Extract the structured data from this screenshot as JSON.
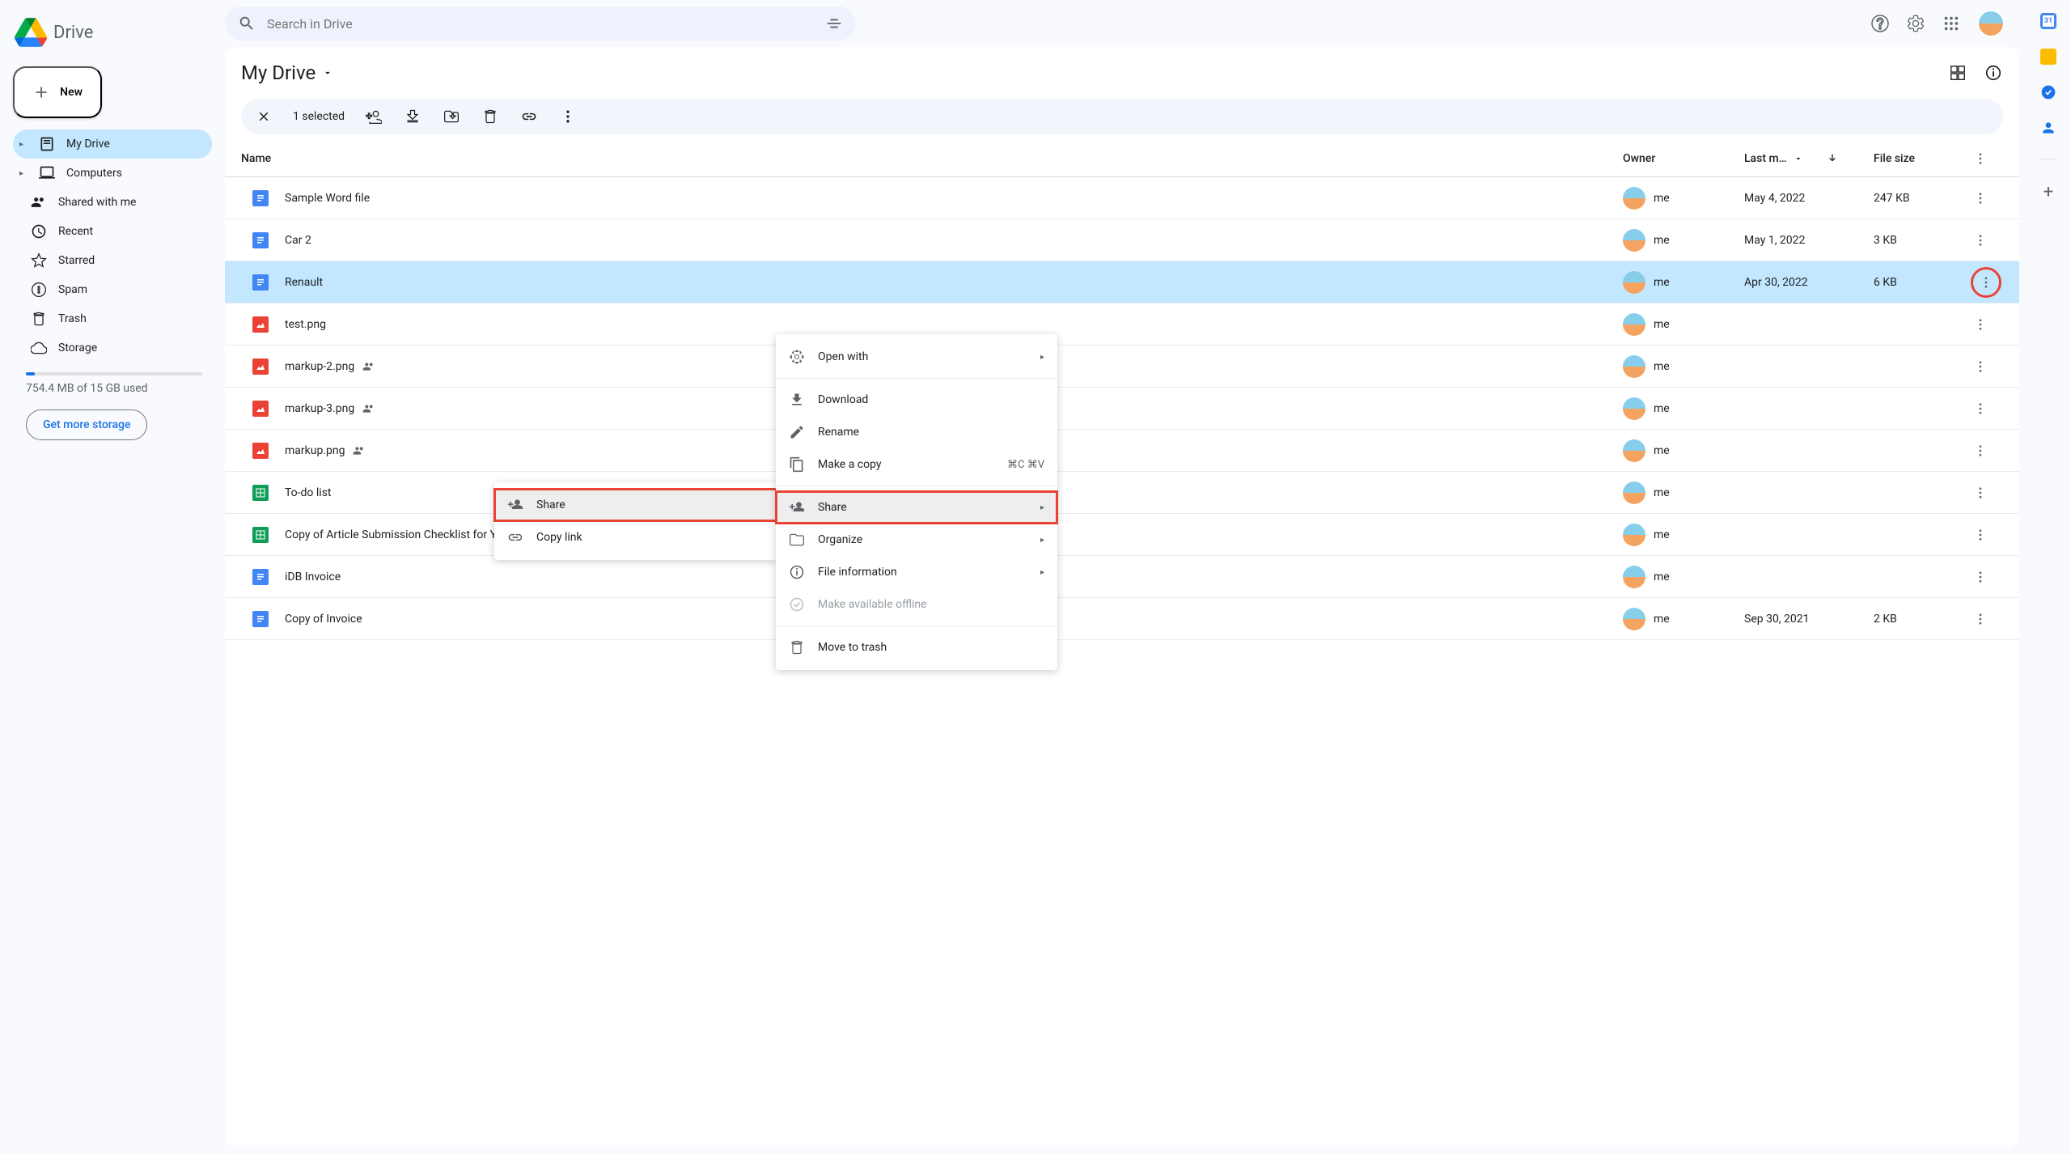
{
  "app": {
    "name": "Drive"
  },
  "search": {
    "placeholder": "Search in Drive"
  },
  "new_button": "New",
  "nav": {
    "my_drive": "My Drive",
    "computers": "Computers",
    "shared": "Shared with me",
    "recent": "Recent",
    "starred": "Starred",
    "spam": "Spam",
    "trash": "Trash",
    "storage": "Storage"
  },
  "storage": {
    "text": "754.4 MB of 15 GB used",
    "cta": "Get more storage"
  },
  "breadcrumb": "My Drive",
  "selection": {
    "count": "1 selected"
  },
  "columns": {
    "name": "Name",
    "owner": "Owner",
    "modified": "Last m…",
    "size": "File size"
  },
  "owner_me": "me",
  "files": [
    {
      "name": "Sample Word file",
      "type": "doc",
      "shared": false,
      "modified": "May 4, 2022",
      "size": "247 KB"
    },
    {
      "name": "Car 2",
      "type": "doc",
      "shared": false,
      "modified": "May 1, 2022",
      "size": "3 KB"
    },
    {
      "name": "Renault",
      "type": "doc",
      "shared": false,
      "modified": "Apr 30, 2022",
      "size": "6 KB",
      "selected": true,
      "menu_highlight": true
    },
    {
      "name": "test.png",
      "type": "img",
      "shared": false,
      "modified": "",
      "size": ""
    },
    {
      "name": "markup-2.png",
      "type": "img",
      "shared": true,
      "modified": "",
      "size": ""
    },
    {
      "name": "markup-3.png",
      "type": "img",
      "shared": true,
      "modified": "",
      "size": ""
    },
    {
      "name": "markup.png",
      "type": "img",
      "shared": true,
      "modified": "",
      "size": ""
    },
    {
      "name": "To-do list",
      "type": "sheet",
      "shared": false,
      "modified": "",
      "size": ""
    },
    {
      "name": "Copy of Article Submission Checklist for Your First Article",
      "type": "sheet",
      "shared": true,
      "modified": "",
      "size": ""
    },
    {
      "name": "iDB Invoice",
      "type": "doc",
      "shared": false,
      "modified": "",
      "size": ""
    },
    {
      "name": "Copy of Invoice",
      "type": "doc",
      "shared": false,
      "modified": "Sep 30, 2021",
      "size": "2 KB"
    }
  ],
  "context_menu": {
    "open_with": "Open with",
    "download": "Download",
    "rename": "Rename",
    "make_copy": "Make a copy",
    "make_copy_shortcut": "⌘C ⌘V",
    "share": "Share",
    "organize": "Organize",
    "file_info": "File information",
    "offline": "Make available offline",
    "trash": "Move to trash"
  },
  "submenu": {
    "share": "Share",
    "copy_link": "Copy link"
  }
}
